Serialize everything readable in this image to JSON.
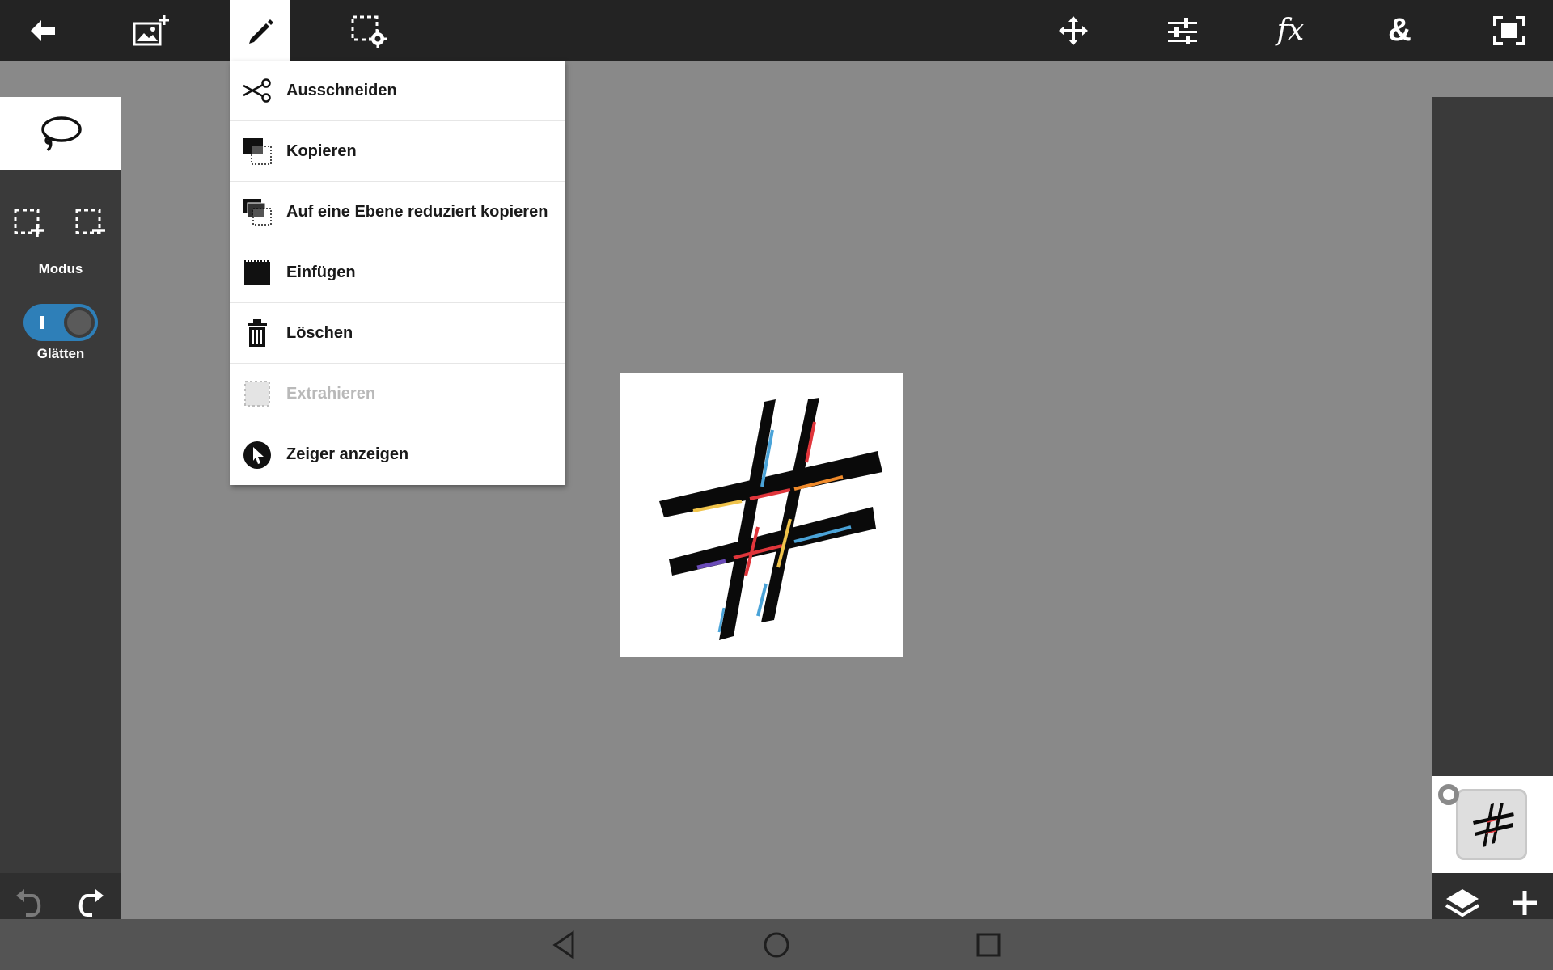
{
  "toolbar": {
    "left": [
      {
        "id": "back",
        "icon": "back-arrow-icon"
      },
      {
        "id": "add-image",
        "icon": "add-image-icon"
      },
      {
        "id": "edit",
        "icon": "pencil-icon",
        "active": true
      },
      {
        "id": "selection-settings",
        "icon": "selection-gear-icon"
      }
    ],
    "right": [
      {
        "id": "move",
        "icon": "move-icon"
      },
      {
        "id": "adjustments",
        "icon": "sliders-icon"
      },
      {
        "id": "effects",
        "icon": "fx-icon",
        "label": "fx"
      },
      {
        "id": "blend",
        "icon": "ampersand-icon",
        "label": "&"
      },
      {
        "id": "fit-screen",
        "icon": "fit-screen-icon"
      }
    ]
  },
  "left_panel": {
    "tool": "lasso-icon",
    "mode_label": "Modus",
    "smooth_label": "Glätten",
    "smooth_on": true
  },
  "edit_menu": {
    "items": [
      {
        "label": "Ausschneiden",
        "icon": "scissors-icon",
        "enabled": true
      },
      {
        "label": "Kopieren",
        "icon": "copy-icon",
        "enabled": true
      },
      {
        "label": "Auf eine Ebene reduziert kopieren",
        "icon": "copy-merged-icon",
        "enabled": true
      },
      {
        "label": "Einfügen",
        "icon": "paste-icon",
        "enabled": true
      },
      {
        "label": "Löschen",
        "icon": "trash-icon",
        "enabled": true
      },
      {
        "label": "Extrahieren",
        "icon": "extract-icon",
        "enabled": false
      },
      {
        "label": "Zeiger anzeigen",
        "icon": "pointer-icon",
        "enabled": true
      }
    ]
  },
  "canvas": {
    "image": "hashtag-brush-image"
  },
  "colors": {
    "toolbar_bg": "#232323",
    "workspace_bg": "#898989",
    "panel_bg": "#3a3a3a",
    "toggle_accent": "#2e7fb8"
  }
}
